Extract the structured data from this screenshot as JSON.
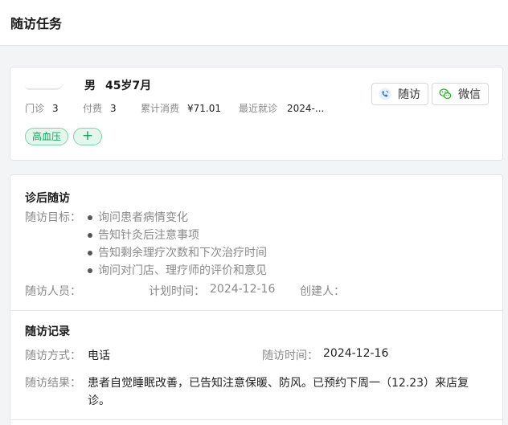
{
  "header": {
    "title": "随访任务"
  },
  "patient": {
    "gender": "男",
    "age": "45岁7月",
    "stats": [
      {
        "label": "门诊",
        "value": "3"
      },
      {
        "label": "付费",
        "value": "3"
      },
      {
        "label": "累计消费",
        "value": "¥71.01"
      },
      {
        "label": "最近就诊",
        "value": "2024-..."
      }
    ],
    "tags": [
      "高血压"
    ],
    "add_tag": "+",
    "buttons": {
      "call": "随访",
      "wechat": "微信"
    }
  },
  "plan": {
    "title": "诊后随访",
    "goal_label": "随访目标：",
    "goals": [
      "询问患者病情变化",
      "告知针灸后注意事项",
      "告知剩余理疗次数和下次治疗时间",
      "询问对门店、理疗师的评价和意见"
    ],
    "staff_label": "随访人员：",
    "plan_time_label": "计划时间：",
    "plan_time": "2024-12-16",
    "creator_label": "创建人："
  },
  "record": {
    "title": "随访记录",
    "method_label": "随访方式：",
    "method": "电话",
    "time_label": "随访时间：",
    "time": "2024-12-16",
    "result_label": "随访结果：",
    "result": "患者自觉睡眠改善，已告知注意保暖、防风。已预约下周一（12.23）来店复诊。"
  },
  "colors": {
    "accent_green": "#12a15c",
    "call_blue": "#2f7de1",
    "wechat_green": "#1aad19"
  }
}
